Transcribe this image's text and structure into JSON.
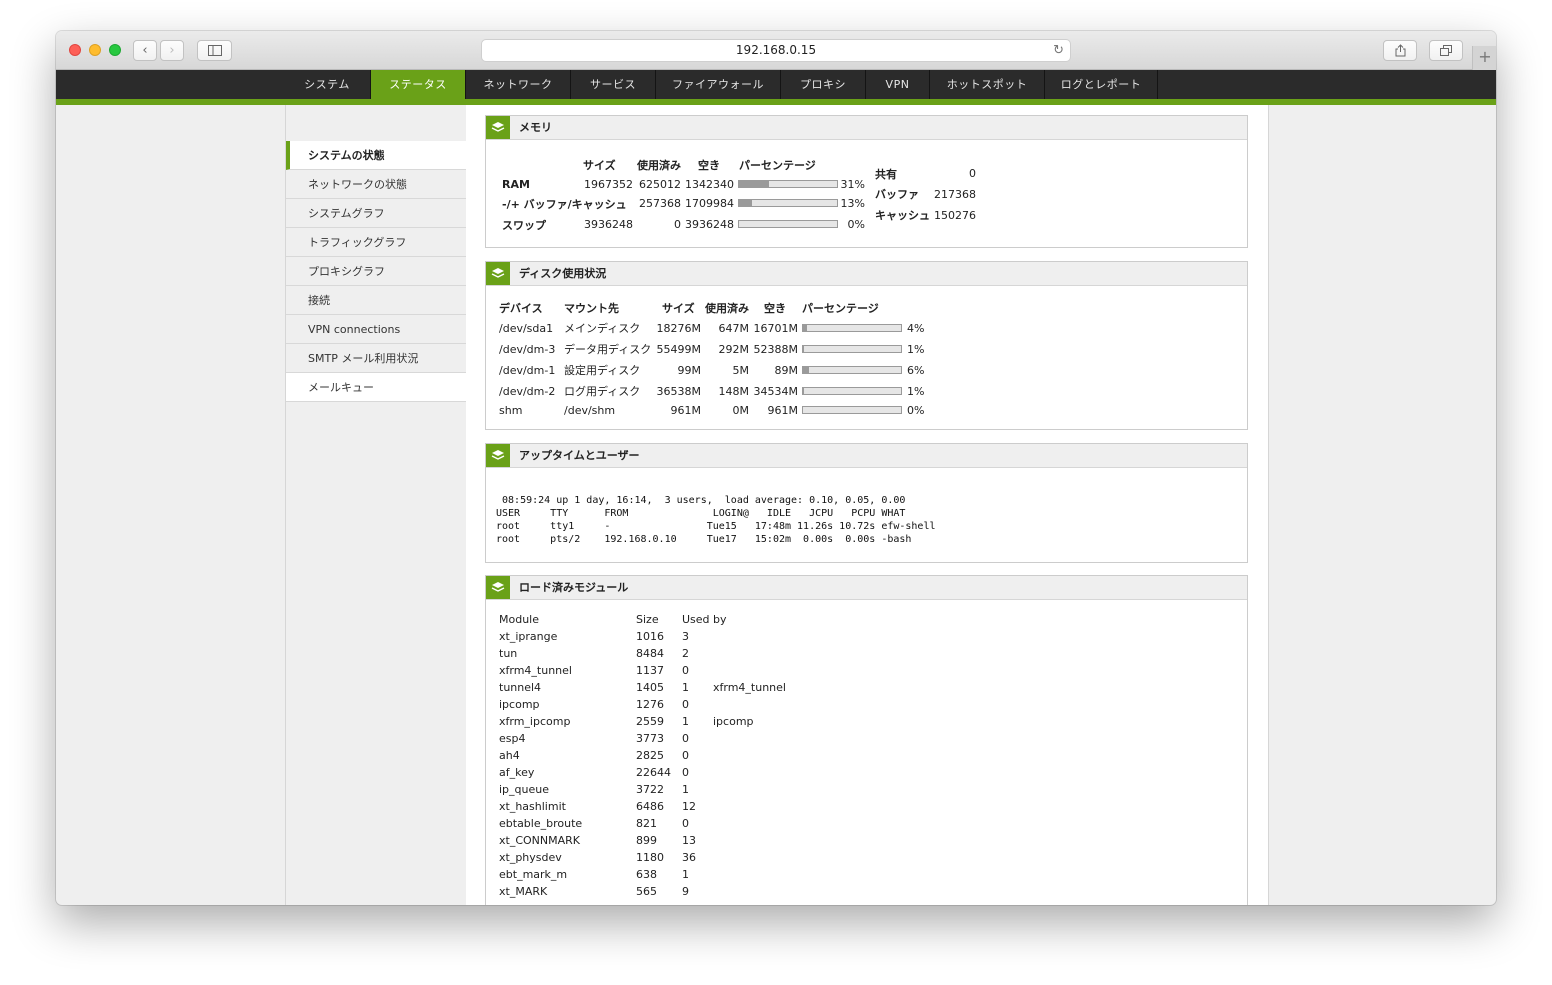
{
  "browser": {
    "url": "192.168.0.15"
  },
  "nav": [
    "システム",
    "ステータス",
    "ネットワーク",
    "サービス",
    "ファイアウォール",
    "プロキシ",
    "VPN",
    "ホットスポット",
    "ログとレポート"
  ],
  "sidebar": [
    "システムの状態",
    "ネットワークの状態",
    "システムグラフ",
    "トラフィックグラフ",
    "プロキシグラフ",
    "接続",
    "VPN connections",
    "SMTP メール利用状況",
    "メールキュー"
  ],
  "memory": {
    "title": "メモリ",
    "headers": [
      "サイズ",
      "使用済み",
      "空き",
      "パーセンテージ"
    ],
    "rows": [
      {
        "label": "RAM",
        "size": "1967352",
        "used": "625012",
        "free": "1342340",
        "pct": "31%",
        "frac": 0.31
      },
      {
        "label": "-/+ バッファ/キャッシュ",
        "size": "",
        "used": "257368",
        "free": "1709984",
        "pct": "13%",
        "frac": 0.13
      },
      {
        "label": "スワップ",
        "size": "3936248",
        "used": "0",
        "free": "3936248",
        "pct": "0%",
        "frac": 0
      }
    ],
    "side": [
      {
        "label": "共有",
        "value": "0"
      },
      {
        "label": "バッファ",
        "value": "217368"
      },
      {
        "label": "キャッシュ",
        "value": "150276"
      }
    ]
  },
  "disk": {
    "title": "ディスク使用状況",
    "headers": [
      "デバイス",
      "マウント先",
      "サイズ",
      "使用済み",
      "空き",
      "パーセンテージ"
    ],
    "rows": [
      {
        "dev": "/dev/sda1",
        "mount": "メインディスク",
        "size": "18276M",
        "used": "647M",
        "free": "16701M",
        "pct": "4%",
        "frac": 0.04
      },
      {
        "dev": "/dev/dm-3",
        "mount": "データ用ディスク",
        "size": "55499M",
        "used": "292M",
        "free": "52388M",
        "pct": "1%",
        "frac": 0.01
      },
      {
        "dev": "/dev/dm-1",
        "mount": "設定用ディスク",
        "size": "99M",
        "used": "5M",
        "free": "89M",
        "pct": "6%",
        "frac": 0.06
      },
      {
        "dev": "/dev/dm-2",
        "mount": "ログ用ディスク",
        "size": "36538M",
        "used": "148M",
        "free": "34534M",
        "pct": "1%",
        "frac": 0.01
      },
      {
        "dev": "shm",
        "mount": "/dev/shm",
        "size": "961M",
        "used": "0M",
        "free": "961M",
        "pct": "0%",
        "frac": 0
      }
    ]
  },
  "uptime": {
    "title": "アップタイムとユーザー",
    "lines": [
      " 08:59:24 up 1 day, 16:14,  3 users,  load average: 0.10, 0.05, 0.00",
      "USER     TTY      FROM              LOGIN@   IDLE   JCPU   PCPU WHAT",
      "root     tty1     -                Tue15   17:48m 11.26s 10.72s efw-shell",
      "root     pts/2    192.168.0.10     Tue17   15:02m  0.00s  0.00s -bash"
    ]
  },
  "modules": {
    "title": "ロード済みモジュール",
    "headers": [
      "Module",
      "Size",
      "Used by"
    ],
    "rows": [
      [
        "xt_iprange",
        "1016",
        "3",
        ""
      ],
      [
        "tun",
        "8484",
        "2",
        ""
      ],
      [
        "xfrm4_tunnel",
        "1137",
        "0",
        ""
      ],
      [
        "tunnel4",
        "1405",
        "1",
        "xfrm4_tunnel"
      ],
      [
        "ipcomp",
        "1276",
        "0",
        ""
      ],
      [
        "xfrm_ipcomp",
        "2559",
        "1",
        "ipcomp"
      ],
      [
        "esp4",
        "3773",
        "0",
        ""
      ],
      [
        "ah4",
        "2825",
        "0",
        ""
      ],
      [
        "af_key",
        "22644",
        "0",
        ""
      ],
      [
        "ip_queue",
        "3722",
        "1",
        ""
      ],
      [
        "xt_hashlimit",
        "6486",
        "12",
        ""
      ],
      [
        "ebtable_broute",
        "821",
        "0",
        ""
      ],
      [
        "xt_CONNMARK",
        "899",
        "13",
        ""
      ],
      [
        "xt_physdev",
        "1180",
        "36",
        ""
      ],
      [
        "ebt_mark_m",
        "638",
        "1",
        ""
      ],
      [
        "xt_MARK",
        "565",
        "9",
        ""
      ]
    ]
  }
}
